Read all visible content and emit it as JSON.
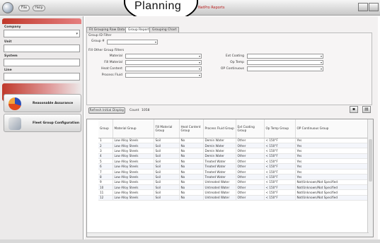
{
  "window": {
    "title": "NetPro Reports",
    "menu": [
      "File",
      "Help"
    ]
  },
  "badge": {
    "text": "Planning"
  },
  "sidebar": {
    "fields": [
      {
        "label": "Company"
      },
      {
        "label": "Unit"
      },
      {
        "label": "System"
      },
      {
        "label": "Line"
      }
    ],
    "nav": [
      {
        "label": "Reasonable Assurance",
        "icon": "pie-chart-icon"
      },
      {
        "label": "Fleet Group Configuration",
        "icon": "pipe-icon"
      }
    ]
  },
  "tabs": [
    "Fit Grouping Raw Data",
    "Group Report",
    "Grouping Chart"
  ],
  "filters": {
    "group_title": "Group ID Filter",
    "group_label": "Group #",
    "other_title": "Fill Other Group Filters",
    "left": [
      "Material",
      "Fill Material",
      "Heat Content",
      "Process Fluid"
    ],
    "right": [
      "Ext Coating",
      "Op Temp",
      "OP Continuous"
    ]
  },
  "actions": {
    "refresh": "Refresh Initial Display",
    "count_label": "Count",
    "count_value": "1058"
  },
  "table": {
    "headers": [
      "Group",
      "Material Group",
      "Fill Material Group",
      "Heat Content Group",
      "Process Fluid Group",
      "Ext Coating Group",
      "Op Temp Group",
      "OP Continuous Group"
    ],
    "rows": [
      [
        "1",
        "Low Alloy Steels",
        "Soil",
        "No",
        "Demin Water",
        "Other",
        "< 150°F",
        "Yes"
      ],
      [
        "2",
        "Low Alloy Steels",
        "Soil",
        "No",
        "Demin Water",
        "Other",
        "< 150°F",
        "Yes"
      ],
      [
        "3",
        "Low Alloy Steels",
        "Soil",
        "No",
        "Demin Water",
        "Other",
        "< 150°F",
        "Yes"
      ],
      [
        "4",
        "Low Alloy Steels",
        "Soil",
        "No",
        "Demin Water",
        "Other",
        "< 150°F",
        "Yes"
      ],
      [
        "5",
        "Low Alloy Steels",
        "Soil",
        "No",
        "Treated Water",
        "Other",
        "< 150°F",
        "Yes"
      ],
      [
        "6",
        "Low Alloy Steels",
        "Soil",
        "No",
        "Treated Water",
        "Other",
        "< 150°F",
        "Yes"
      ],
      [
        "7",
        "Low Alloy Steels",
        "Soil",
        "No",
        "Treated Water",
        "Other",
        "< 150°F",
        "Yes"
      ],
      [
        "8",
        "Low Alloy Steels",
        "Soil",
        "No",
        "Treated Water",
        "Other",
        "< 150°F",
        "Yes"
      ],
      [
        "9",
        "Low Alloy Steels",
        "Soil",
        "No",
        "Untreated Water",
        "Other",
        "< 150°F",
        "Not/Unknown/Not Specified"
      ],
      [
        "10",
        "Low Alloy Steels",
        "Soil",
        "No",
        "Untreated Water",
        "Other",
        "< 150°F",
        "Not/Unknown/Not Specified"
      ],
      [
        "11",
        "Low Alloy Steels",
        "Soil",
        "No",
        "Untreated Water",
        "Other",
        "< 150°F",
        "Not/Unknown/Not Specified"
      ],
      [
        "12",
        "Low Alloy Steels",
        "Soil",
        "No",
        "Untreated Water",
        "Other",
        "< 150°F",
        "Not/Unknown/Not Specified"
      ]
    ]
  },
  "colors": {
    "accent": "#c0392b",
    "panel": "#f3f1f1"
  }
}
